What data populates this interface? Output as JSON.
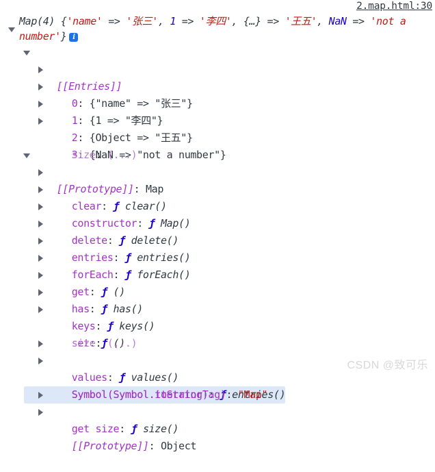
{
  "source": {
    "link_label": "2.map.html:30"
  },
  "watermark": {
    "text": "CSDN @致可乐"
  },
  "colors": {
    "string": "#c41a16",
    "number": "#1c00cf",
    "key": "#a333c8",
    "key_dim": "#bb7fd0",
    "plain": "#303942",
    "highlight": "#dce8f7",
    "info_badge": "#1a73e8",
    "triangle": "#5f6672"
  },
  "root": {
    "toggle_icon": "triangle-down-icon",
    "type_label": "Map(4)",
    "preview": {
      "open_brace": "{",
      "entries": [
        {
          "key": "'name'",
          "key_kind": "string",
          "arrow": " => ",
          "value": "'张三'",
          "value_kind": "string",
          "sep": ", "
        },
        {
          "key": "1",
          "key_kind": "number",
          "arrow": " => ",
          "value": "'李四'",
          "value_kind": "string",
          "sep": ", "
        },
        {
          "key": "{…}",
          "key_kind": "punct",
          "arrow": " => ",
          "value": "'王五'",
          "value_kind": "string",
          "sep": ", "
        },
        {
          "key": "NaN",
          "key_kind": "nan",
          "arrow": " => ",
          "value": "'not a number'",
          "value_kind": "string",
          "sep": ""
        }
      ],
      "close_brace": "}"
    },
    "info_badge": "i"
  },
  "entries_node": {
    "toggle_icon": "triangle-down-icon",
    "label": "[[Entries]]",
    "items": [
      {
        "index": "0",
        "colon": ": ",
        "value": "{\"name\" => \"张三\"}",
        "toggle_icon": "triangle-right-icon"
      },
      {
        "index": "1",
        "colon": ": ",
        "value": "{1 => \"李四\"}",
        "toggle_icon": "triangle-right-icon"
      },
      {
        "index": "2",
        "colon": ": ",
        "value": "{Object => \"王五\"}",
        "toggle_icon": "triangle-right-icon"
      },
      {
        "index": "3",
        "colon": ": ",
        "value": "{NaN => \"not a number\"}",
        "toggle_icon": "triangle-right-icon"
      }
    ],
    "size_row": {
      "key": "size",
      "colon": ": ",
      "value": "(...)"
    }
  },
  "prototype_node": {
    "toggle_icon": "triangle-down-icon",
    "label": "[[Prototype]]",
    "colon": ": ",
    "type": "Map",
    "members": [
      {
        "name": "clear",
        "colon": ": ",
        "fn_mark": "ƒ",
        "fn_sig": "clear()",
        "expandable": true,
        "highlight": false
      },
      {
        "name": "constructor",
        "colon": ": ",
        "fn_mark": "ƒ",
        "fn_sig": "Map()",
        "expandable": true,
        "highlight": false
      },
      {
        "name": "delete",
        "colon": ": ",
        "fn_mark": "ƒ",
        "fn_sig": "delete()",
        "expandable": true,
        "highlight": false
      },
      {
        "name": "entries",
        "colon": ": ",
        "fn_mark": "ƒ",
        "fn_sig": "entries()",
        "expandable": true,
        "highlight": false
      },
      {
        "name": "forEach",
        "colon": ": ",
        "fn_mark": "ƒ",
        "fn_sig": "forEach()",
        "expandable": true,
        "highlight": false
      },
      {
        "name": "get",
        "colon": ": ",
        "fn_mark": "ƒ",
        "fn_sig": "()",
        "expandable": true,
        "highlight": false
      },
      {
        "name": "has",
        "colon": ": ",
        "fn_mark": "ƒ",
        "fn_sig": "has()",
        "expandable": true,
        "highlight": false
      },
      {
        "name": "keys",
        "colon": ": ",
        "fn_mark": "ƒ",
        "fn_sig": "keys()",
        "expandable": true,
        "highlight": false
      },
      {
        "name": "set",
        "colon": ": ",
        "fn_mark": "ƒ",
        "fn_sig": "()",
        "expandable": true,
        "highlight": false
      }
    ],
    "size_row": {
      "key": "size",
      "colon": ": ",
      "value": "(...)"
    },
    "members_after": [
      {
        "name": "values",
        "colon": ": ",
        "fn_mark": "ƒ",
        "fn_sig": "values()",
        "expandable": true,
        "highlight": false
      }
    ],
    "symbol_iterator": {
      "name": "Symbol(Symbol.iterator)",
      "colon": ": ",
      "fn_mark": "ƒ",
      "fn_sig": "entries()",
      "expandable": true,
      "highlight": true
    },
    "symbol_tostringtag": {
      "name": "Symbol(Symbol.toStringTag)",
      "colon": ": ",
      "value": "\"Map\""
    },
    "get_size": {
      "name": "get size",
      "colon": ": ",
      "fn_mark": "ƒ",
      "fn_sig": "size()",
      "expandable": true
    },
    "nested_prototype": {
      "label": "[[Prototype]]",
      "colon": ": ",
      "type": "Object",
      "toggle_icon": "triangle-right-icon"
    }
  }
}
